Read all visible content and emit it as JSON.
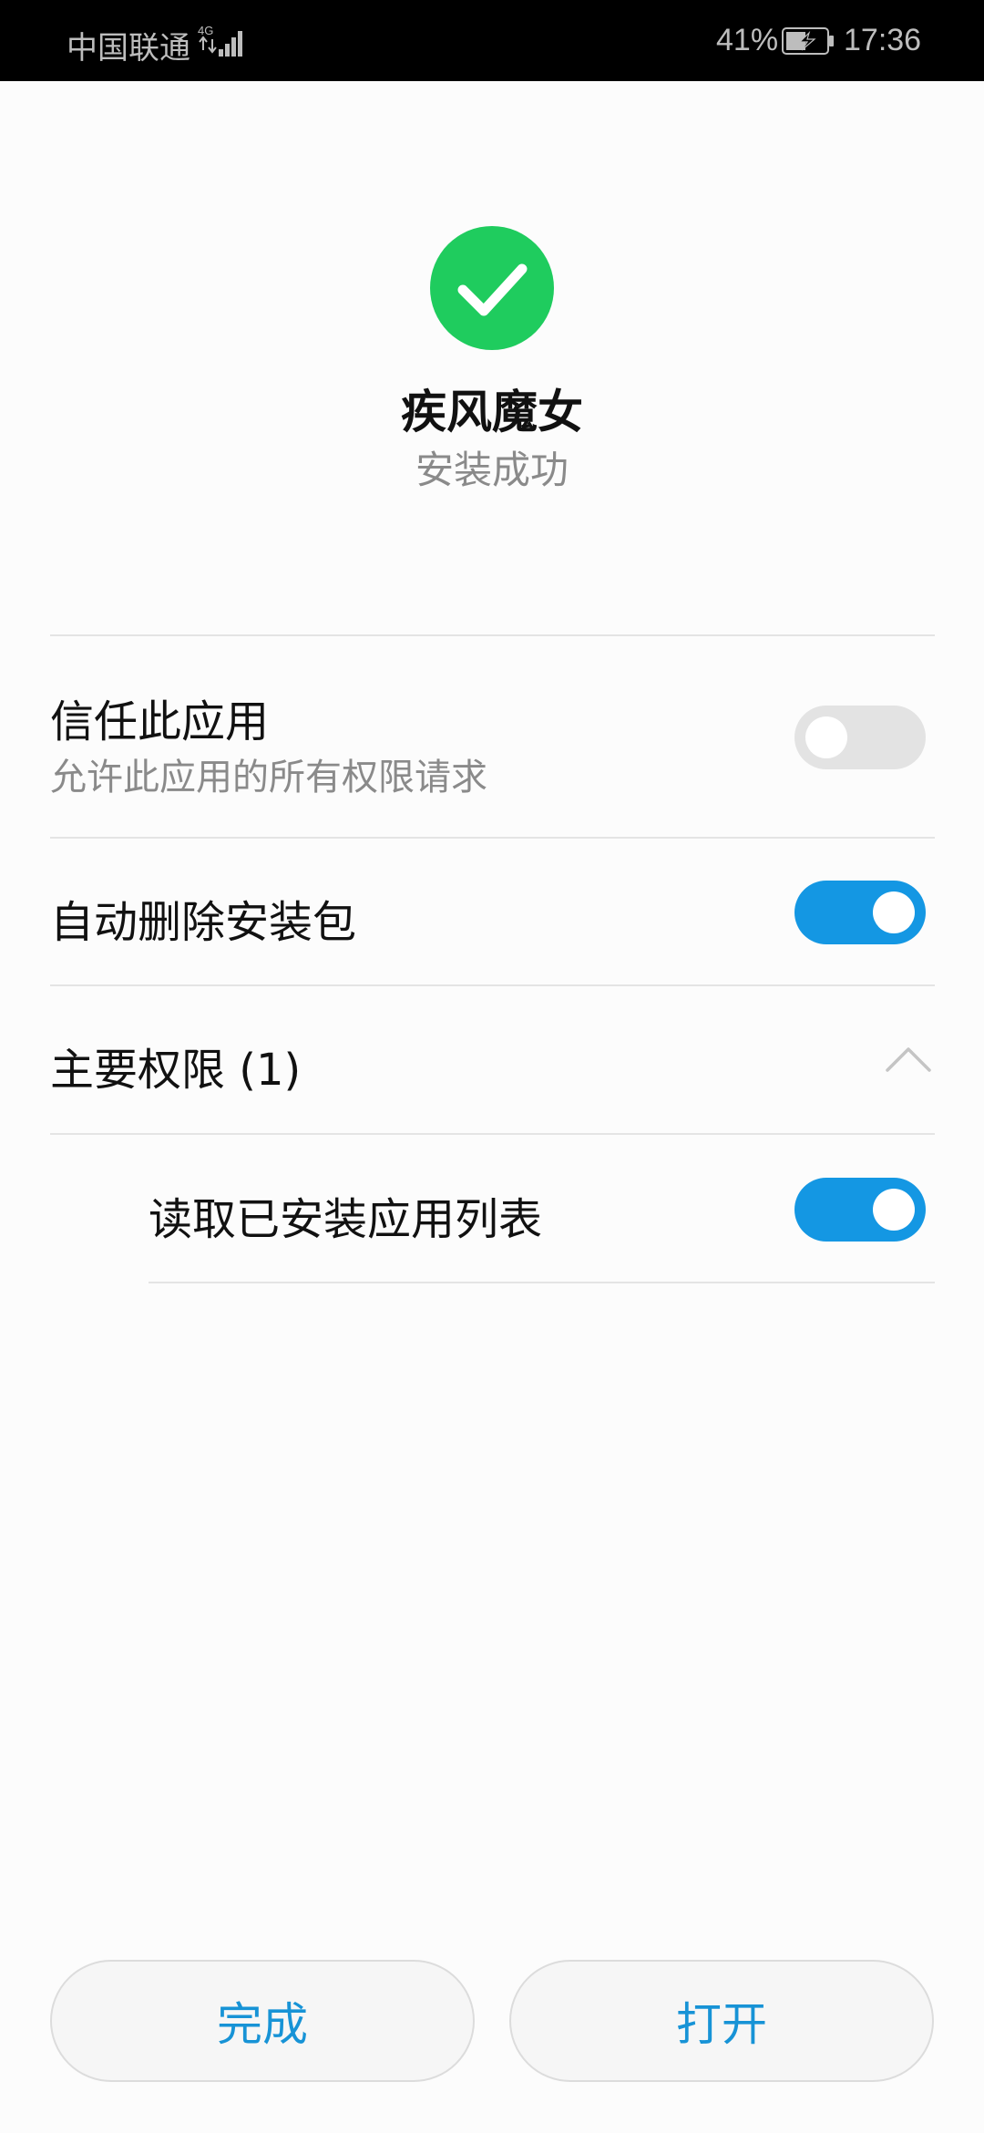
{
  "status_bar": {
    "carrier": "中国联通",
    "network_type": "4G",
    "battery_percent": "41%",
    "time": "17:36"
  },
  "app": {
    "name": "疾风魔女",
    "install_status": "安装成功"
  },
  "settings": {
    "trust_app": {
      "title": "信任此应用",
      "subtitle": "允许此应用的所有权限请求",
      "enabled": false
    },
    "auto_delete": {
      "title": "自动删除安装包",
      "enabled": true
    }
  },
  "permissions": {
    "header": "主要权限 (1)",
    "expanded": true,
    "items": [
      {
        "label": "读取已安装应用列表",
        "enabled": true
      }
    ]
  },
  "buttons": {
    "done": "完成",
    "open": "打开"
  },
  "colors": {
    "accent": "#1497e3",
    "success": "#1fcc5e",
    "button_text": "#1793d6"
  },
  "icons": [
    "network-signal-icon",
    "battery-charging-icon",
    "check-circle-icon",
    "chevron-up-icon"
  ]
}
